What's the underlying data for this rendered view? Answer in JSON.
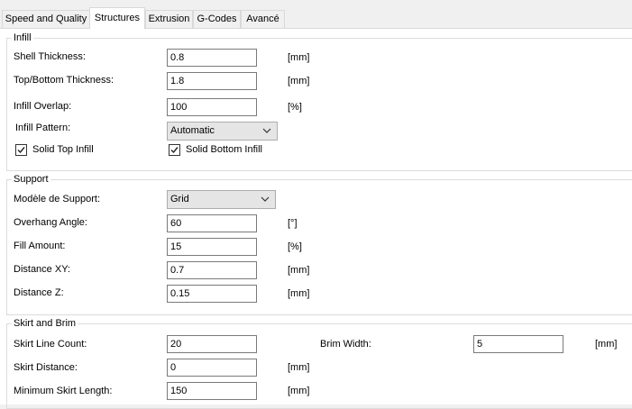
{
  "tabs": [
    {
      "label": "Speed and Quality"
    },
    {
      "label": "Structures"
    },
    {
      "label": "Extrusion"
    },
    {
      "label": "G-Codes"
    },
    {
      "label": "Avancé"
    }
  ],
  "active_tab": "Structures",
  "infill": {
    "legend": "Infill",
    "shell_thickness": {
      "label": "Shell Thickness:",
      "value": "0.8",
      "unit": "[mm]"
    },
    "top_bottom_thickness": {
      "label": "Top/Bottom Thickness:",
      "value": "1.8",
      "unit": "[mm]"
    },
    "infill_overlap": {
      "label": "Infill Overlap:",
      "value": "100",
      "unit": "[%]"
    },
    "infill_pattern": {
      "label": "Infill Pattern:",
      "value": "Automatic"
    },
    "solid_top": {
      "label": "Solid Top Infill",
      "checked": true
    },
    "solid_bottom": {
      "label": "Solid Bottom Infill",
      "checked": true
    }
  },
  "support": {
    "legend": "Support",
    "model": {
      "label": "Modèle de Support:",
      "value": "Grid"
    },
    "overhang_angle": {
      "label": "Overhang Angle:",
      "value": "60",
      "unit": "[°]"
    },
    "fill_amount": {
      "label": "Fill Amount:",
      "value": "15",
      "unit": "[%]"
    },
    "distance_xy": {
      "label": "Distance XY:",
      "value": "0.7",
      "unit": "[mm]"
    },
    "distance_z": {
      "label": "Distance Z:",
      "value": "0.15",
      "unit": "[mm]"
    }
  },
  "skirt": {
    "legend": "Skirt and Brim",
    "line_count": {
      "label": "Skirt Line Count:",
      "value": "20"
    },
    "brim_width": {
      "label": "Brim Width:",
      "value": "5",
      "unit": "[mm]"
    },
    "distance": {
      "label": "Skirt Distance:",
      "value": "0",
      "unit": "[mm]"
    },
    "min_length": {
      "label": "Minimum Skirt Length:",
      "value": "150",
      "unit": "[mm]"
    }
  }
}
